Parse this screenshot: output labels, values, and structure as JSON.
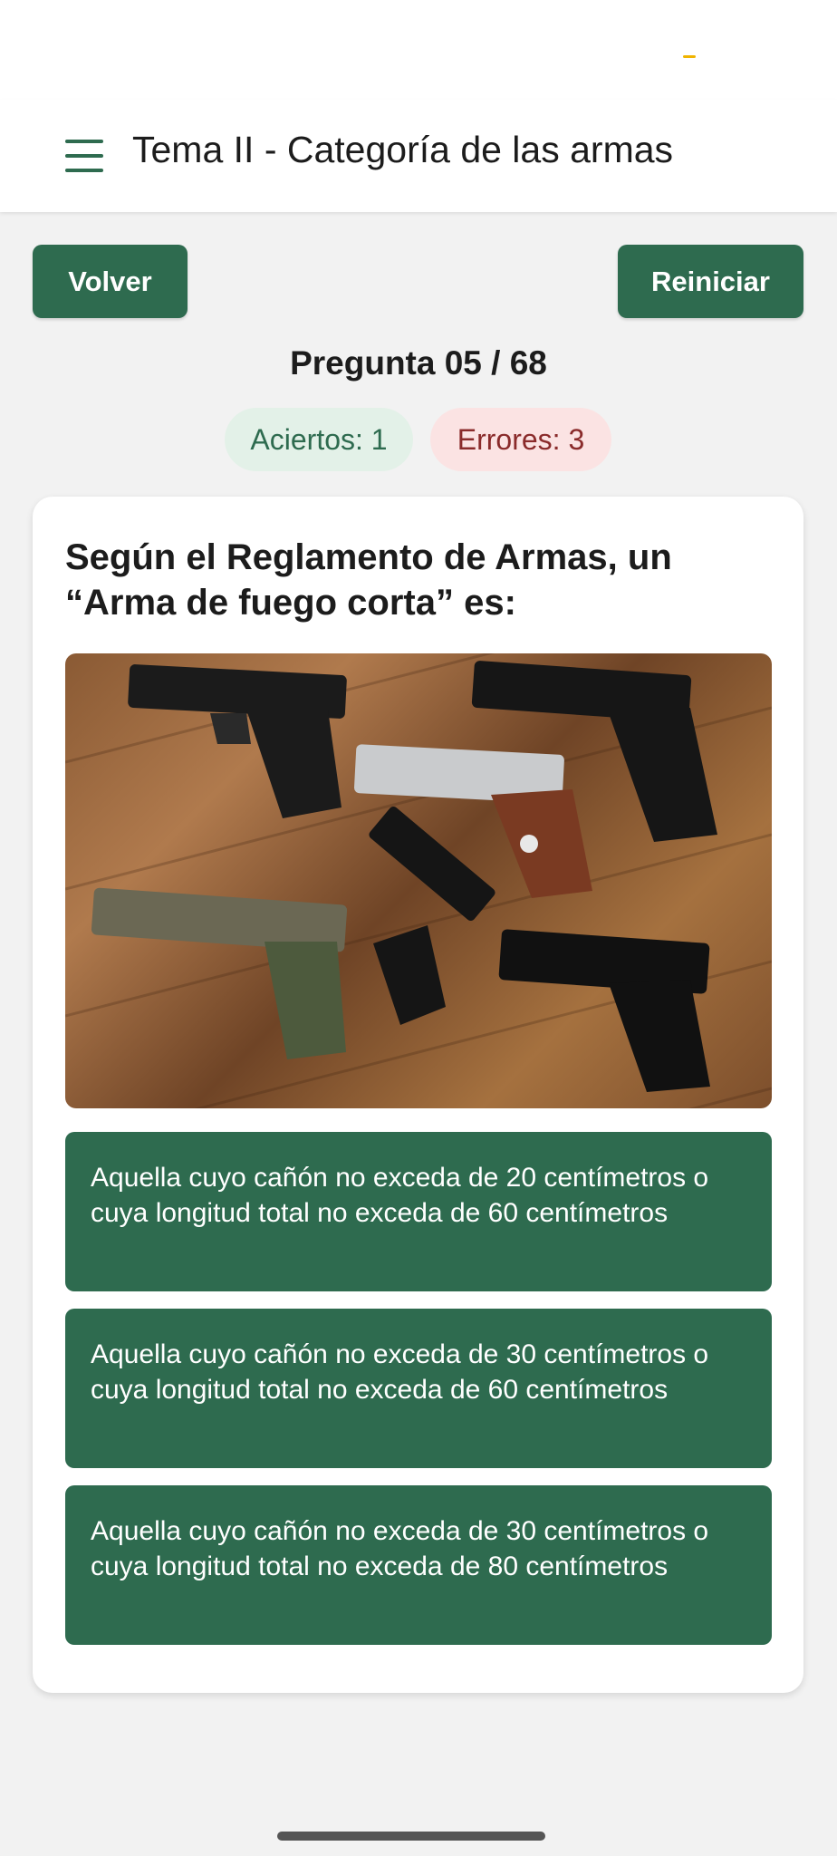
{
  "header": {
    "title": "Tema II - Categoría de las armas"
  },
  "toolbar": {
    "back_label": "Volver",
    "restart_label": "Reiniciar"
  },
  "progress": {
    "counter": "Pregunta 05 / 68",
    "correct": "Aciertos: 1",
    "errors": "Errores: 3"
  },
  "question": {
    "text": "Según el Reglamento de Armas, un “Arma de fuego corta” es:",
    "image": "handguns-photo"
  },
  "answers": [
    {
      "text": "Aquella cuyo cañón no exceda de 20 centímetros o cuya longitud total no exceda de 60 centímetros"
    },
    {
      "text": "Aquella cuyo cañón no exceda de 30 centímetros o cuya longitud total no exceda de 60 centímetros"
    },
    {
      "text": "Aquella cuyo cañón no exceda de 30 centímetros o cuya longitud total no exceda de 80 centímetros"
    }
  ],
  "colors": {
    "primary": "#2e6b4f",
    "correct_bg": "#e3f1e8",
    "errors_bg": "#fbe3e3",
    "errors_text": "#8a2b2b"
  }
}
